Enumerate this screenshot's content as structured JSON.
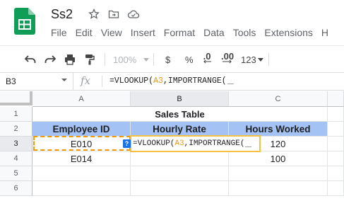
{
  "app": {
    "doc_title": "Ss2",
    "menus": [
      "File",
      "Edit",
      "View",
      "Insert",
      "Format",
      "Data",
      "Tools",
      "Extensions",
      "H"
    ],
    "brand_color": "#0f9d58"
  },
  "toolbar": {
    "zoom": "100%",
    "currency": "$",
    "percent": "%",
    "dec_decrease": ".0",
    "dec_increase": ".00",
    "more_formats": "123"
  },
  "formula_bar": {
    "cell_ref": "B3",
    "fx": "fx",
    "formula_prefix": "=VLOOKUP(",
    "formula_ref": "A3",
    "formula_suffix": ",IMPORTRANGE("
  },
  "grid": {
    "columns": [
      "A",
      "B",
      "C"
    ],
    "rows": [
      "1",
      "2",
      "3",
      "4",
      "5",
      "6"
    ],
    "selected_column": "B",
    "selected_row": "3",
    "table_title": "Sales Table",
    "headers": [
      "Employee ID",
      "Hourly Rate",
      "Hours Worked"
    ],
    "data": [
      [
        "E010",
        "",
        "120"
      ],
      [
        "E014",
        "",
        "100"
      ]
    ],
    "header_fill": "#a4c2f4",
    "editor_border": "#f4c242",
    "reference_color": "#f29900",
    "help_badge": "?"
  }
}
